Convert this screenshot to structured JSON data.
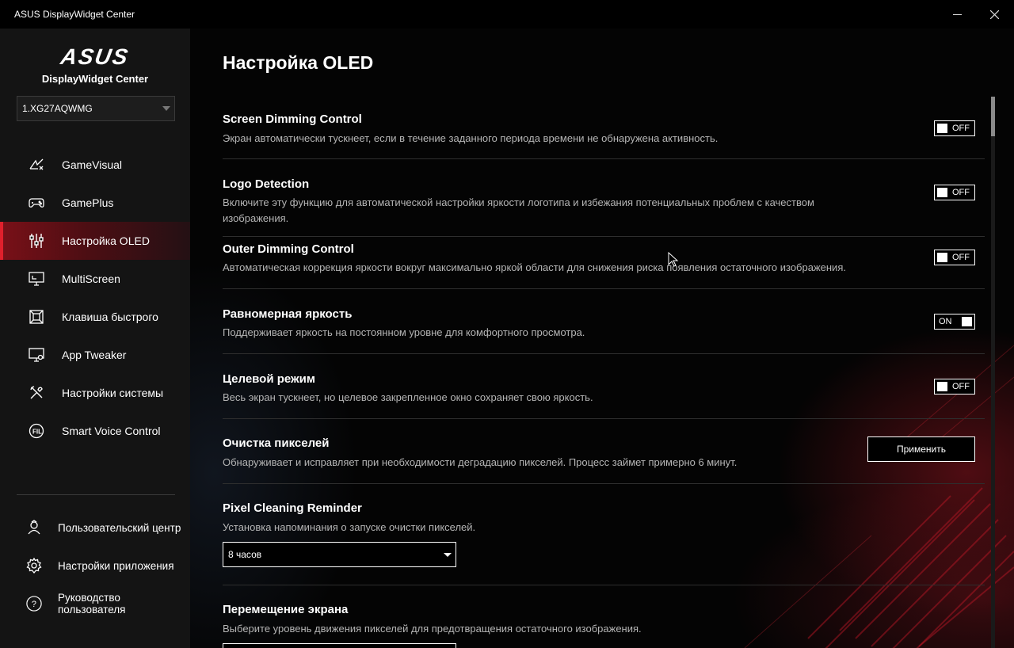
{
  "window": {
    "title": "ASUS DisplayWidget Center"
  },
  "sidebar": {
    "brand": "ASUS",
    "product": "DisplayWidget Center",
    "monitor": "1.XG27AQWMG",
    "items": [
      {
        "label": "GameVisual",
        "icon": "gamevisual-icon"
      },
      {
        "label": "GamePlus",
        "icon": "gamepad-icon"
      },
      {
        "label": "Настройка OLED",
        "icon": "oled-sliders-icon",
        "active": true
      },
      {
        "label": "MultiScreen",
        "icon": "multiscreen-icon"
      },
      {
        "label": "Клавиша быстрого",
        "icon": "hotkey-icon"
      },
      {
        "label": "App Tweaker",
        "icon": "app-tweaker-icon"
      },
      {
        "label": "Настройки системы",
        "icon": "tools-icon"
      },
      {
        "label": "Smart Voice Control",
        "icon": "voice-control-icon"
      }
    ],
    "bottom_items": [
      {
        "label": "Пользовательский центр",
        "icon": "user-center-icon"
      },
      {
        "label": "Настройки приложения",
        "icon": "gear-icon"
      },
      {
        "label": "Руководство пользователя",
        "icon": "help-icon"
      }
    ]
  },
  "main": {
    "title": "Настройка OLED",
    "settings": [
      {
        "title": "Screen Dimming Control",
        "desc": "Экран автоматически тускнеет, если в течение заданного периода времени не обнаружена активность.",
        "state": "OFF"
      },
      {
        "title": "Logo Detection",
        "desc": "Включите эту функцию для автоматической настройки яркости логотипа и избежания потенциальных проблем с качеством изображения.",
        "state": "OFF"
      },
      {
        "title": "Outer Dimming Control",
        "desc": "Автоматическая коррекция яркости вокруг максимально яркой области для снижения риска появления остаточного изображения.",
        "state": "OFF"
      },
      {
        "title": "Равномерная яркость",
        "desc": "Поддерживает яркость на постоянном уровне для комфортного просмотра.",
        "state": "ON"
      },
      {
        "title": "Целевой режим",
        "desc": "Весь экран тускнеет, но целевое закрепленное окно сохраняет свою яркость.",
        "state": "OFF"
      },
      {
        "title": "Очистка пикселей",
        "desc": "Обнаруживает и исправляет при необходимости деградацию пикселей. Процесс займет примерно 6 минут.",
        "button": "Применить"
      },
      {
        "title": "Pixel Cleaning Reminder",
        "desc": "Установка напоминания о запуске очистки пикселей.",
        "select": "8 часов"
      },
      {
        "title": "Перемещение экрана",
        "desc": "Выберите уровень движения пикселей для предотвращения остаточного изображения."
      }
    ]
  },
  "colors": {
    "accent": "#e0202c",
    "active_bg": "#5a0f16",
    "sidebar_bg": "#141414",
    "main_bg": "#040404"
  }
}
